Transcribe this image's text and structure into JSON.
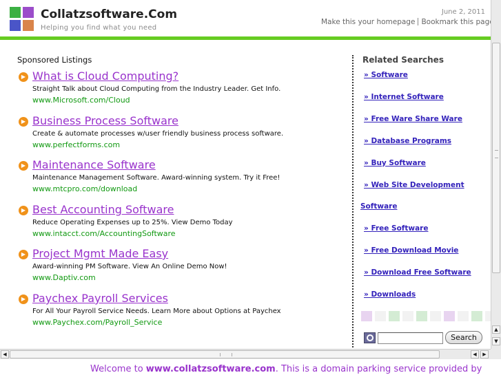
{
  "header": {
    "site_name": "Collatzsoftware.Com",
    "tagline": "Helping you find what you need",
    "date": "June 2, 2011",
    "homepage_link": "Make this your homepage",
    "bookmark_link": "Bookmark this page"
  },
  "logo_colors": [
    "#3cb043",
    "#9b4dca",
    "#4a55c8",
    "#d9844a"
  ],
  "colors": {
    "accent_green": "#66cc22",
    "link_purple": "#9933cc",
    "url_green": "#119911",
    "bullet_orange": "#f0921a",
    "related_link": "#3322bb"
  },
  "sponsored": {
    "heading": "Sponsored Listings",
    "icon": "orange-play-bullet-icon",
    "items": [
      {
        "title": "What is Cloud Computing?",
        "desc": "Straight Talk about Cloud Computing from the Industry Leader. Get Info.",
        "url": "www.Microsoft.com/Cloud"
      },
      {
        "title": "Business Process Software",
        "desc": "Create & automate processes w/user friendly business process software.",
        "url": "www.perfectforms.com"
      },
      {
        "title": "Maintenance Software",
        "desc": "Maintenance Management Software. Award-winning system. Try it Free!",
        "url": "www.mtcpro.com/download"
      },
      {
        "title": "Best Accounting Software",
        "desc": "Reduce Operating Expenses up to 25%. View Demo Today",
        "url": "www.intacct.com/AccountingSoftware"
      },
      {
        "title": "Project Mgmt Made Easy",
        "desc": "Award-winning PM Software. View An Online Demo Now!",
        "url": "www.Daptiv.com"
      },
      {
        "title": "Paychex Payroll Services",
        "desc": "For All Your Payroll Service Needs. Learn More about Options at Paychex",
        "url": "www.Paychex.com/Payroll_Service"
      }
    ]
  },
  "related": {
    "heading": "Related Searches",
    "items": [
      "» Software",
      "» Internet Software",
      "» Free Ware Share Ware",
      "» Database Programs",
      "» Buy Software",
      "» Web Site Development",
      "Software",
      "» Free Software",
      "» Free Download Movie",
      "» Download Free Software",
      "» Downloads"
    ],
    "swatch_colors": [
      "#e8d4f0",
      "#f2f2f2",
      "#d4ecd4",
      "#f2f2f2",
      "#d4ecd4",
      "#f2f2f2",
      "#e8d4f0",
      "#f2f2f2",
      "#d4ecd4",
      "#f2f2f2"
    ]
  },
  "search": {
    "icon": "search-icon",
    "button_label": "Search",
    "placeholder": ""
  },
  "scrollbars": {
    "up_icon": "▲",
    "down_icon": "▼",
    "left_icon": "◀",
    "right_icon": "▶"
  },
  "footer": {
    "prefix": "Welcome to ",
    "domain": "www.collatzsoftware.com",
    "suffix": ". This is a domain parking service provided by"
  }
}
